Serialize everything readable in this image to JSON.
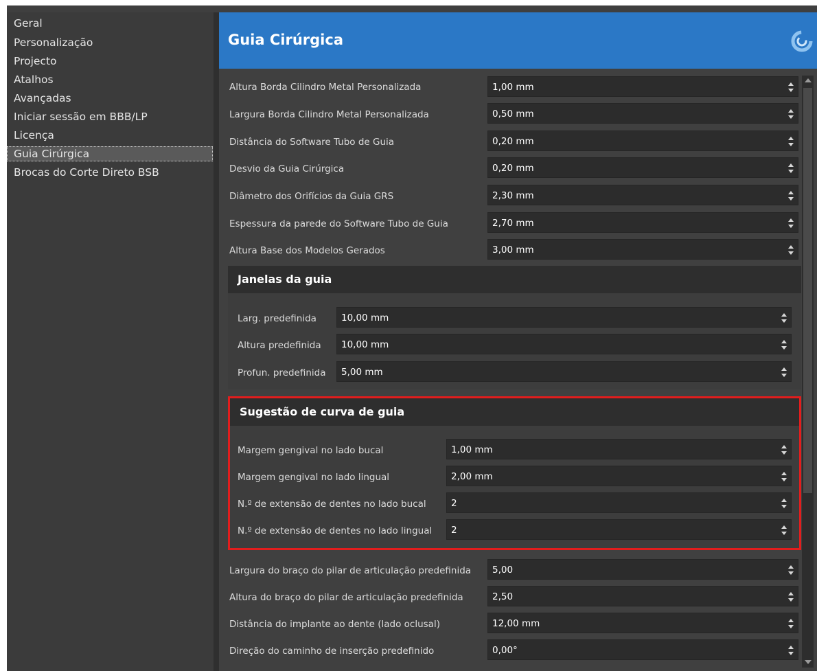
{
  "sidebar": {
    "items": [
      {
        "label": "Geral"
      },
      {
        "label": "Personalização"
      },
      {
        "label": "Projecto"
      },
      {
        "label": "Atalhos"
      },
      {
        "label": "Avançadas"
      },
      {
        "label": "Iniciar sessão em BBB/LP"
      },
      {
        "label": "Licença"
      },
      {
        "label": "Guia Cirúrgica",
        "selected": true
      },
      {
        "label": "Brocas do Corte Direto BSB"
      }
    ]
  },
  "header": {
    "title": "Guia Cirúrgica",
    "icon": "blue-swirl-logo-icon",
    "color": "#2b78c6"
  },
  "settings": [
    {
      "label": "Altura Borda Cilindro Metal Personalizada",
      "value": "1,00 mm"
    },
    {
      "label": "Largura Borda Cilindro Metal Personalizada",
      "value": "0,50 mm"
    },
    {
      "label": "Distância do Software Tubo de Guia",
      "value": "0,20 mm"
    },
    {
      "label": "Desvio da Guia Cirúrgica",
      "value": "0,20 mm"
    },
    {
      "label": "Diâmetro dos Orifícios da Guia GRS",
      "value": "2,30 mm"
    },
    {
      "label": "Espessura da parede do Software Tubo de Guia",
      "value": "2,70 mm"
    },
    {
      "label": "Altura Base dos Modelos Gerados",
      "value": "3,00 mm"
    }
  ],
  "guide_windows": {
    "title": "Janelas da guia",
    "rows": [
      {
        "label": "Larg. predefinida",
        "value": "10,00 mm"
      },
      {
        "label": "Altura predefinida",
        "value": "10,00 mm"
      },
      {
        "label": "Profun. predefinida",
        "value": "5,00 mm"
      }
    ]
  },
  "guide_curve": {
    "title": "Sugestão de curva de guia",
    "highlight_color": "#e21d1d",
    "rows": [
      {
        "label": "Margem gengival no lado bucal",
        "value": "1,00 mm"
      },
      {
        "label": "Margem gengival no lado lingual",
        "value": "2,00 mm"
      },
      {
        "label": "N.º de extensão de dentes no lado bucal",
        "value": "2"
      },
      {
        "label": "N.º de extensão de dentes no lado lingual",
        "value": "2"
      }
    ]
  },
  "settings_after": [
    {
      "label": "Largura do braço do pilar de articulação predefinida",
      "value": "5,00"
    },
    {
      "label": "Altura do braço do pilar de articulação predefinida",
      "value": "2,50"
    },
    {
      "label": "Distância do implante ao dente (lado oclusal)",
      "value": "12,00 mm"
    },
    {
      "label": "Direção do caminho de inserção predefinido",
      "value": "0,00°"
    }
  ]
}
